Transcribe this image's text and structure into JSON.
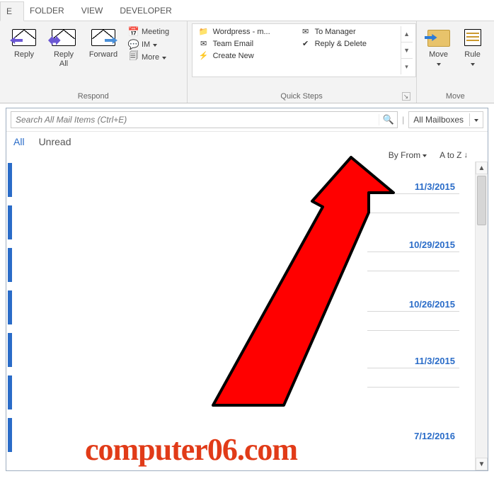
{
  "tabs": {
    "t0": "E",
    "t1": "FOLDER",
    "t2": "VIEW",
    "t3": "DEVELOPER"
  },
  "ribbon": {
    "respond": {
      "reply": "Reply",
      "reply_all": "Reply\nAll",
      "forward": "Forward",
      "meeting": "Meeting",
      "im": "IM",
      "more": "More",
      "group_label": "Respond"
    },
    "quicksteps": {
      "group_label": "Quick Steps",
      "c1_1": "Wordpress - m...",
      "c1_2": "Team Email",
      "c1_3": "Create New",
      "c2_1": "To Manager",
      "c2_2": "Reply & Delete"
    },
    "move": {
      "move": "Move",
      "rules": "Rule",
      "group_label": "Move"
    }
  },
  "search": {
    "placeholder": "Search All Mail Items (Ctrl+E)",
    "scope": "All Mailboxes"
  },
  "filters": {
    "all": "All",
    "unread": "Unread"
  },
  "sort": {
    "by": "By From",
    "order": "A to Z"
  },
  "messages": {
    "d1": "11/3/2015",
    "d2": "10/29/2015",
    "d3": "10/26/2015",
    "d4": "11/3/2015",
    "d5": "7/12/2016"
  },
  "watermark": "computer06.com"
}
